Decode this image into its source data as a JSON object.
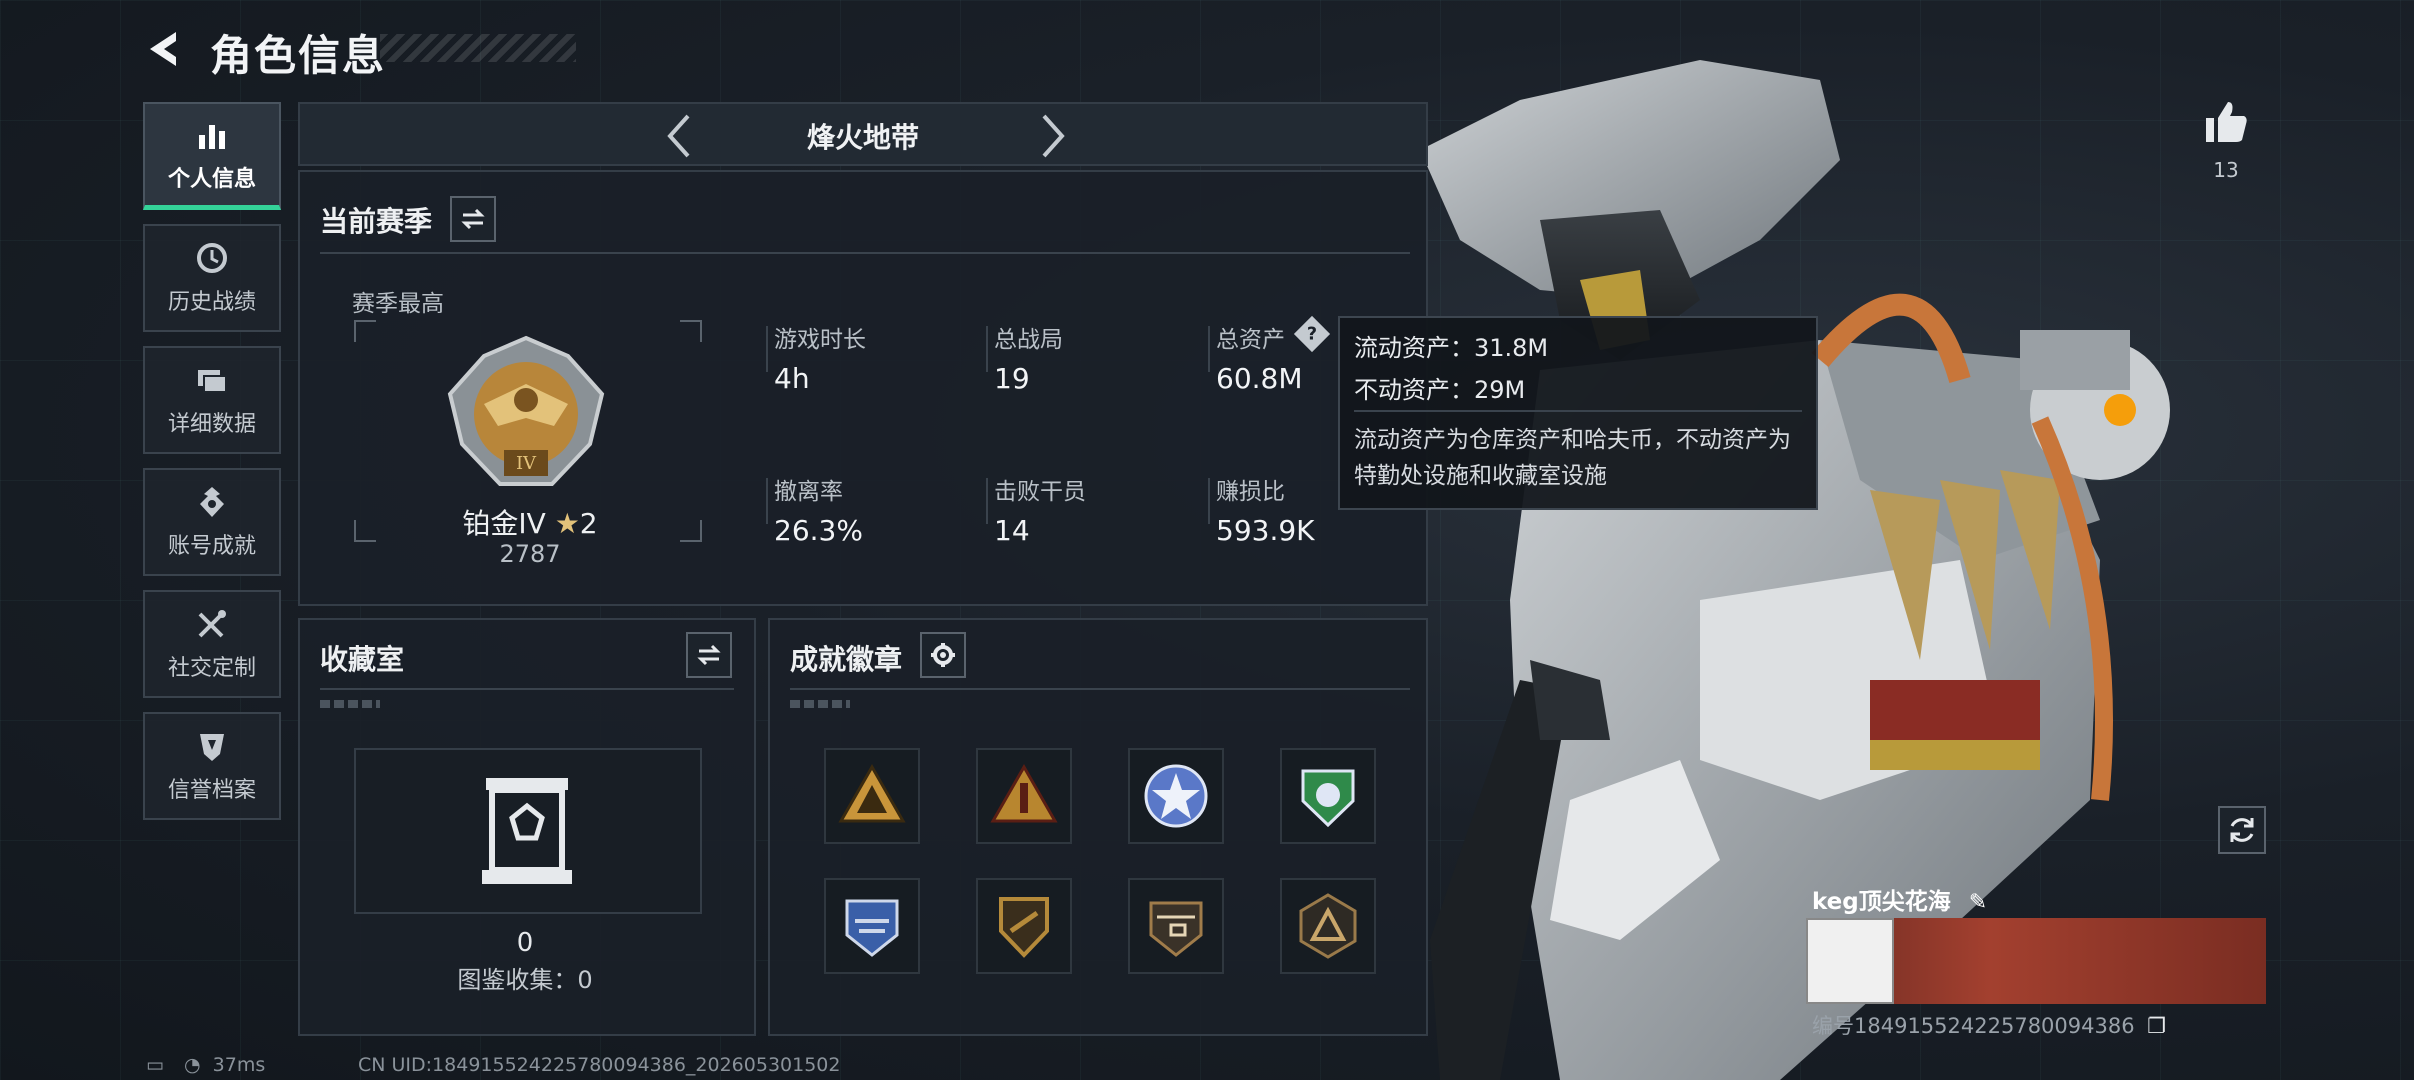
{
  "header": {
    "title": "角色信息"
  },
  "nav": {
    "items": [
      {
        "label": "个人信息",
        "active": true,
        "icon": "bar-chart-icon"
      },
      {
        "label": "历史战绩",
        "active": false,
        "icon": "clock-history-icon"
      },
      {
        "label": "详细数据",
        "active": false,
        "icon": "folders-icon"
      },
      {
        "label": "账号成就",
        "active": false,
        "icon": "medal-icon"
      },
      {
        "label": "社交定制",
        "active": false,
        "icon": "tools-icon"
      },
      {
        "label": "信誉档案",
        "active": false,
        "icon": "shield-icon"
      }
    ]
  },
  "season_bar": {
    "mode": "烽火地带"
  },
  "current_season": {
    "title": "当前赛季",
    "best_label": "赛季最高",
    "rank_name": "铂金IV",
    "rank_stars": "2",
    "rank_points": "2787",
    "rank_emblem_numeral": "IV",
    "stats": [
      {
        "label": "游戏时长",
        "value": "4h"
      },
      {
        "label": "总战局",
        "value": "19"
      },
      {
        "label": "总资产",
        "value": "60.8M"
      },
      {
        "label": "撤离率",
        "value": "26.3%"
      },
      {
        "label": "击败干员",
        "value": "14"
      },
      {
        "label": "赚损比",
        "value": "593.9K"
      }
    ]
  },
  "tooltip": {
    "liquid": "流动资产：31.8M",
    "fixed": "不动资产：29M",
    "description": "流动资产为仓库资产和哈夫币，不动资产为特勤处设施和收藏室设施"
  },
  "collection": {
    "title": "收藏室",
    "count": "0",
    "catalog": "图鉴收集：0"
  },
  "badges": {
    "title": "成就徽章",
    "items": [
      {
        "name": "triangle-squad-badge",
        "color": "#c9953a"
      },
      {
        "name": "triangle-rocket-badge",
        "color": "#b8862f"
      },
      {
        "name": "star-seal-badge",
        "color": "#5a78c8"
      },
      {
        "name": "green-shield-badge",
        "color": "#2f8a4a"
      },
      {
        "name": "blue-emblem-badge",
        "color": "#3a5fa8"
      },
      {
        "name": "gold-shield-badge",
        "color": "#b58a3a"
      },
      {
        "name": "helicopter-badge",
        "color": "#a07c4a"
      },
      {
        "name": "hexagon-triangle-badge",
        "color": "#9a7a4a"
      }
    ]
  },
  "social": {
    "likes": "13"
  },
  "player": {
    "name": "keg顶尖花海",
    "id": "编号1849155242257800943​86"
  },
  "footer": {
    "ping": "37ms",
    "uid": "CN UID:18491552422578009438​6_202605301502"
  }
}
